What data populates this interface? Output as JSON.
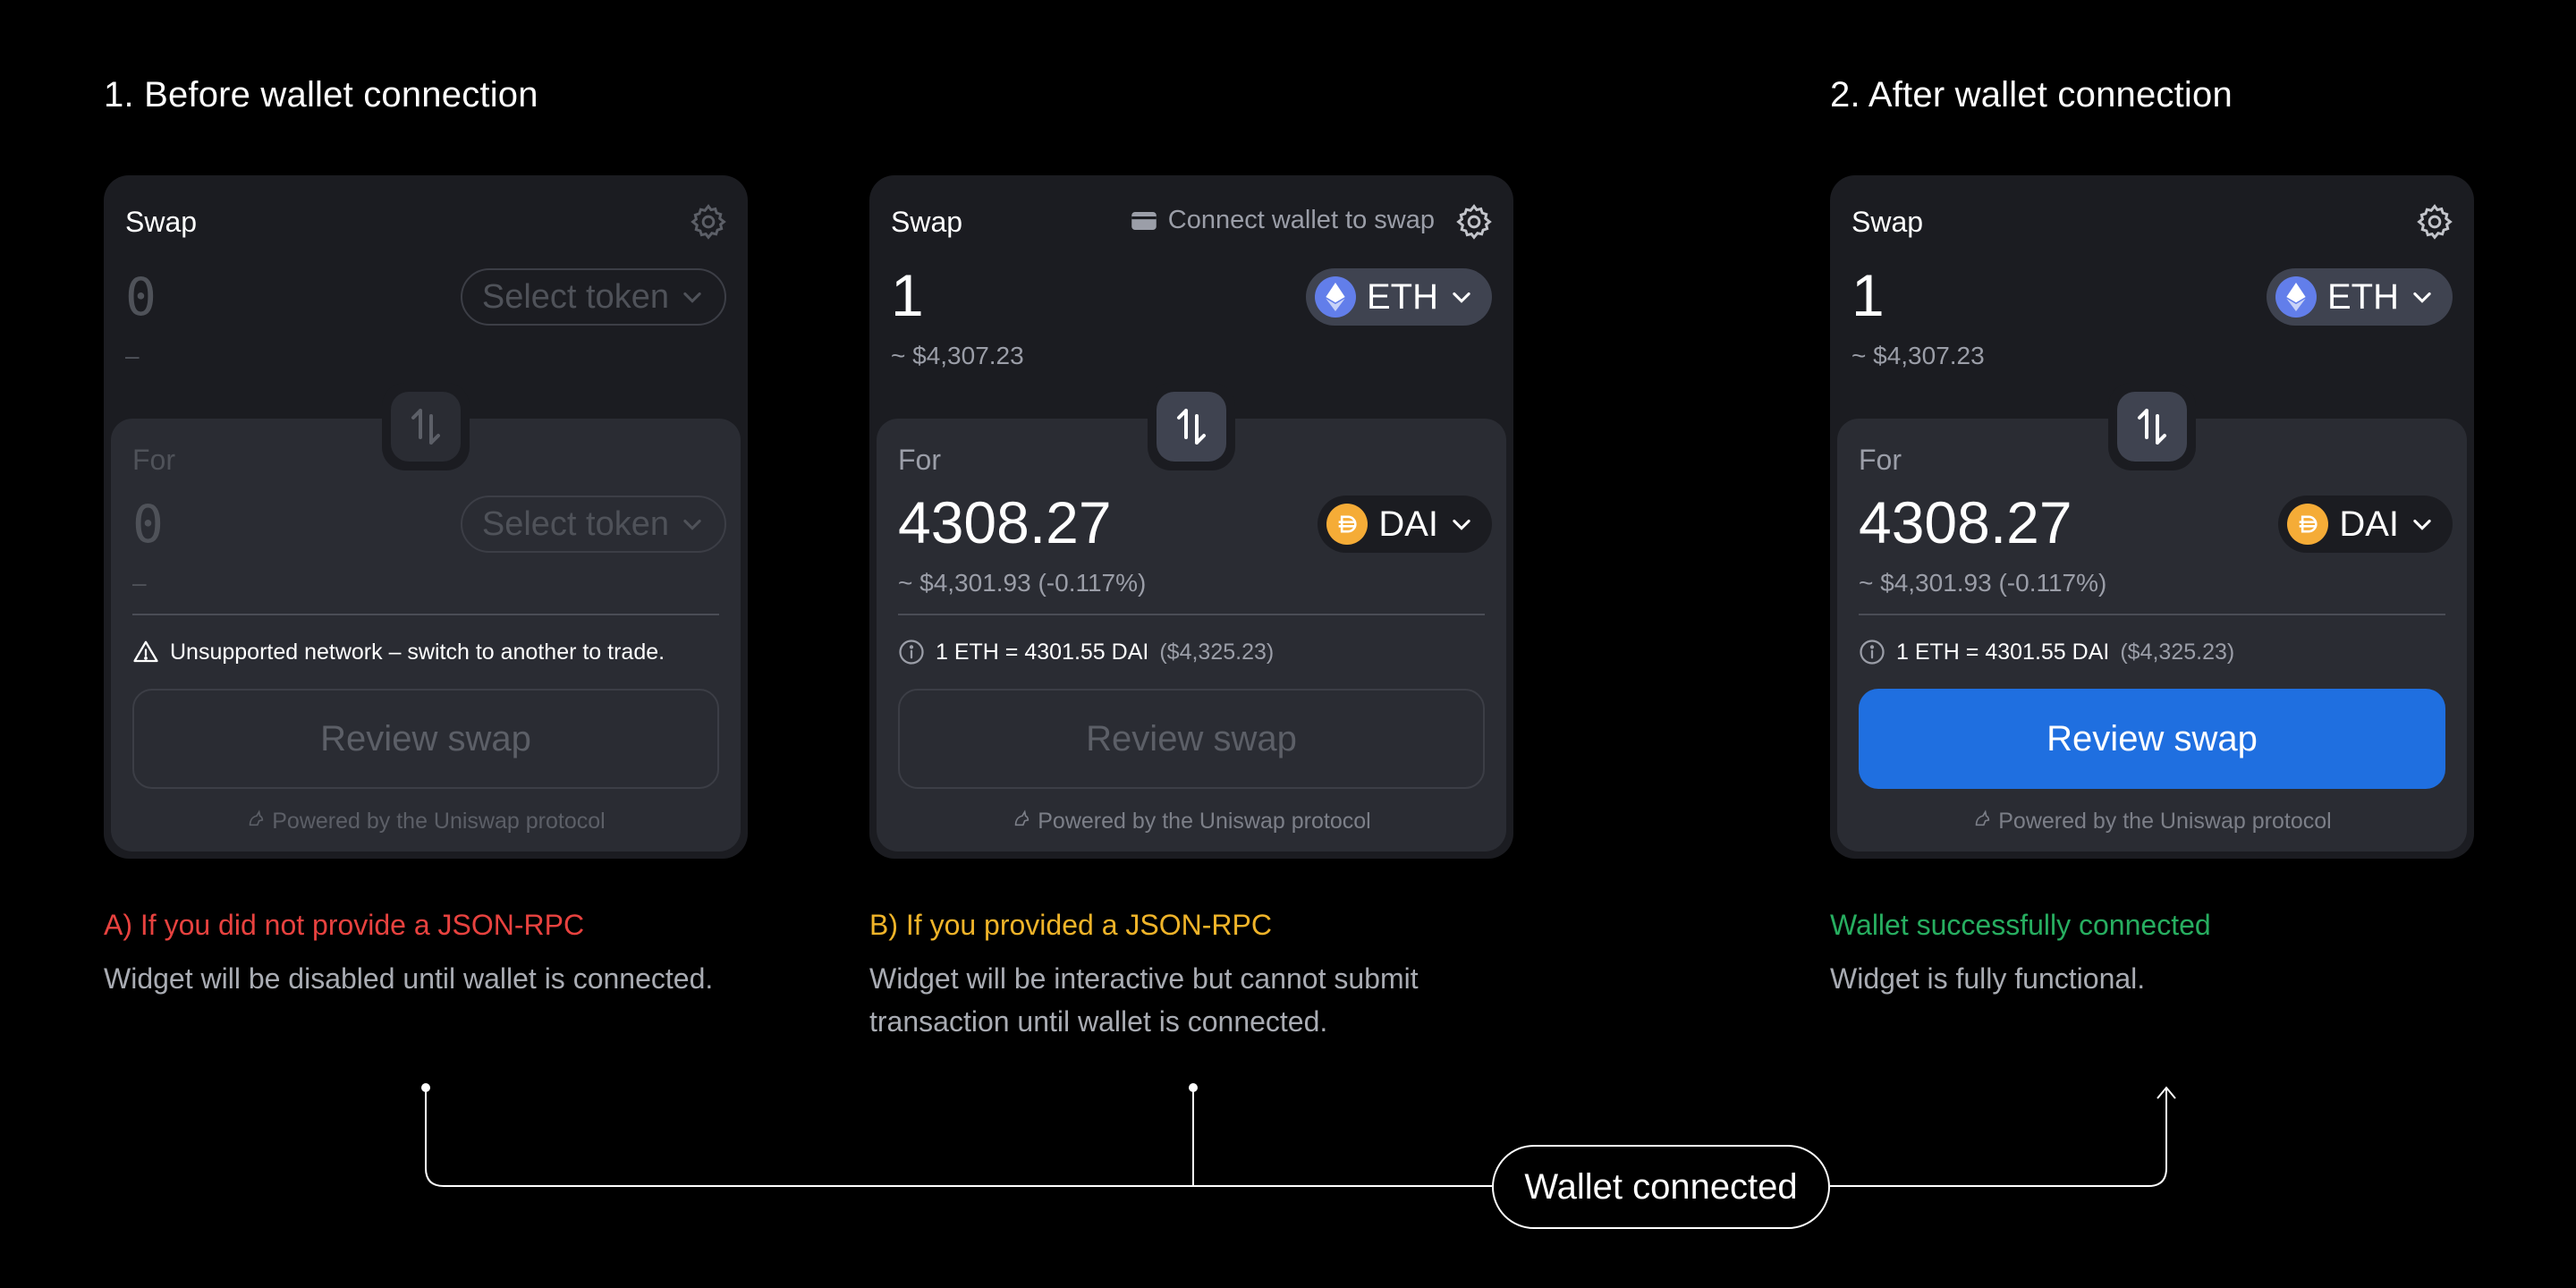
{
  "headings": {
    "before": "1. Before wallet connection",
    "after": "2. After wallet connection"
  },
  "widgets": [
    {
      "title": "Swap",
      "input_amount": "0",
      "input_usd": "–",
      "input_token": "Select token",
      "output_label": "For",
      "output_amount": "0",
      "output_usd": "–",
      "output_token": "Select token",
      "notice": "Unsupported network – switch to another to trade.",
      "review_label": "Review swap",
      "powered": "Powered by the Uniswap protocol"
    },
    {
      "title": "Swap",
      "connect_hint": "Connect wallet to swap",
      "input_amount": "1",
      "input_usd": "~ $4,307.23",
      "input_token": "ETH",
      "output_label": "For",
      "output_amount": "4308.27",
      "output_usd": "~ $4,301.93 (-0.117%)",
      "output_token": "DAI",
      "rate": "1 ETH = 4301.55 DAI",
      "rate_usd": "($4,325.23)",
      "review_label": "Review swap",
      "powered": "Powered by the Uniswap protocol"
    },
    {
      "title": "Swap",
      "input_amount": "1",
      "input_usd": "~ $4,307.23",
      "input_token": "ETH",
      "output_label": "For",
      "output_amount": "4308.27",
      "output_usd": "~ $4,301.93 (-0.117%)",
      "output_token": "DAI",
      "rate": "1 ETH = 4301.55 DAI",
      "rate_usd": "($4,325.23)",
      "review_label": "Review swap",
      "powered": "Powered by the Uniswap protocol"
    }
  ],
  "captions": [
    {
      "title": "A) If you did not provide a JSON-RPC",
      "body": "Widget will be disabled until wallet is connected.",
      "color": "#e8423f"
    },
    {
      "title": "B) If you provided a JSON-RPC",
      "body": "Widget will be interactive but cannot submit transaction until wallet is connected.",
      "color": "#f0b429"
    },
    {
      "title": "Wallet successfully connected",
      "body": "Widget is fully functional.",
      "color": "#27ae60"
    }
  ],
  "flow_label": "Wallet connected",
  "colors": {
    "background": "#000000",
    "widget": "#1b1c21",
    "panel": "#2a2c33",
    "accent": "#1f6fe0",
    "eth": "#627eea",
    "dai": "#f5ac37"
  }
}
